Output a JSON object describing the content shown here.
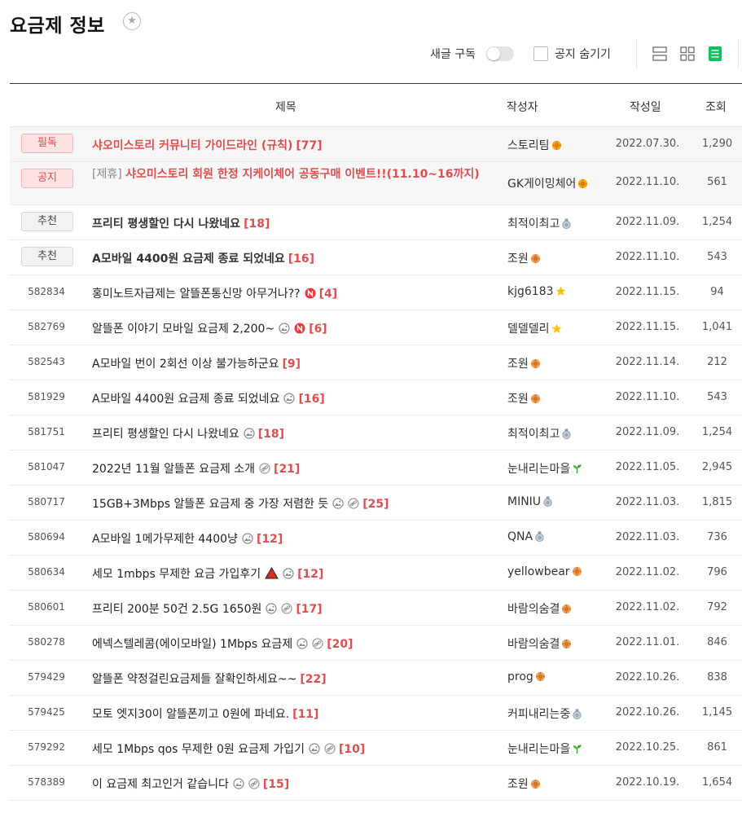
{
  "page": {
    "title": "요금제 정보"
  },
  "toolbar": {
    "subscribe_label": "새글 구독",
    "hide_notice_label": "공지 숨기기"
  },
  "table": {
    "headers": {
      "title": "제목",
      "author": "작성자",
      "date": "작성일",
      "views": "조회"
    },
    "rows": [
      {
        "badge": "필독",
        "badge_style": "red",
        "pre": "",
        "title": "샤오미스토리 커뮤니티 가이드라인 (규칙)",
        "title_style": "red",
        "comments": "[77]",
        "icons": [],
        "author": "스토리팀",
        "level": "gold",
        "date": "2022.07.30.",
        "views": "1,290",
        "notice": true,
        "tall": false
      },
      {
        "badge": "공지",
        "badge_style": "red",
        "pre": "[제휴] ",
        "title": "샤오미스토리 회원 한정 지케이체어 공동구매 이벤트!!(11.10~16까지)",
        "title_style": "red",
        "comments": "",
        "icons": [],
        "author": "GK게이밍체어",
        "level": "gold",
        "date": "2022.11.10.",
        "views": "561",
        "notice": true,
        "tall": true
      },
      {
        "badge": "추천",
        "badge_style": "gray",
        "pre": "",
        "title": "프리티 평생할인 다시 나왔네요",
        "title_style": "bold",
        "comments": "[18]",
        "icons": [],
        "author": "최적이최고",
        "level": "silver",
        "date": "2022.11.09.",
        "views": "1,254",
        "notice": false,
        "tall": false
      },
      {
        "badge": "추천",
        "badge_style": "gray",
        "pre": "",
        "title": "A모바일 4400원 요금제 종료 되었네요",
        "title_style": "bold",
        "comments": "[16]",
        "icons": [],
        "author": "조원",
        "level": "orange",
        "date": "2022.11.10.",
        "views": "543",
        "notice": false,
        "tall": false
      },
      {
        "num": "582834",
        "pre": "",
        "title": "홍미노트자급제는 알뜰폰통신망 아무거나??",
        "title_style": "",
        "comments": "[4]",
        "icons": [
          "new"
        ],
        "author": "kjg6183",
        "level": "star",
        "date": "2022.11.15.",
        "views": "94"
      },
      {
        "num": "582769",
        "pre": "",
        "title": "알뜰폰 이야기 모바일 요금제 2,200~",
        "title_style": "",
        "comments": "[6]",
        "icons": [
          "photo",
          "new"
        ],
        "author": "델델델리",
        "level": "star",
        "date": "2022.11.15.",
        "views": "1,041"
      },
      {
        "num": "582543",
        "pre": "",
        "title": "A모바일 번이 2회선 이상 불가능하군요",
        "title_style": "",
        "comments": "[9]",
        "icons": [],
        "author": "조원",
        "level": "orange",
        "date": "2022.11.14.",
        "views": "212"
      },
      {
        "num": "581929",
        "pre": "",
        "title": "A모바일 4400원 요금제 종료 되었네요",
        "title_style": "",
        "comments": "[16]",
        "icons": [
          "photo"
        ],
        "author": "조원",
        "level": "orange",
        "date": "2022.11.10.",
        "views": "543"
      },
      {
        "num": "581751",
        "pre": "",
        "title": "프리티 평생할인 다시 나왔네요",
        "title_style": "",
        "comments": "[18]",
        "icons": [
          "photo"
        ],
        "author": "최적이최고",
        "level": "silver",
        "date": "2022.11.09.",
        "views": "1,254"
      },
      {
        "num": "581047",
        "pre": "",
        "title": "2022년 11월 알뜰폰 요금제 소개",
        "title_style": "",
        "comments": "[21]",
        "icons": [
          "link"
        ],
        "author": "눈내리는마을",
        "level": "sprout",
        "date": "2022.11.05.",
        "views": "2,945"
      },
      {
        "num": "580717",
        "pre": "",
        "title": "15GB+3Mbps 알뜰폰 요금제 중 가장 저렴한 듯",
        "title_style": "",
        "comments": "[25]",
        "icons": [
          "photo",
          "link"
        ],
        "author": "MINIU",
        "level": "silver",
        "date": "2022.11.03.",
        "views": "1,815"
      },
      {
        "num": "580694",
        "pre": "",
        "title": "A모바일 1메가무제한 4400냥",
        "title_style": "",
        "comments": "[12]",
        "icons": [
          "photo"
        ],
        "author": "QNA",
        "level": "silver",
        "date": "2022.11.03.",
        "views": "736"
      },
      {
        "num": "580634",
        "pre": "",
        "title": "세모 1mbps 무제한 요금 가입후기",
        "title_style": "",
        "comments": "[12]",
        "icons": [
          "triangle",
          "photo"
        ],
        "author": "yellowbear",
        "level": "orange",
        "date": "2022.11.02.",
        "views": "796"
      },
      {
        "num": "580601",
        "pre": "",
        "title": "프리티 200분 50건 2.5G 1650원",
        "title_style": "",
        "comments": "[17]",
        "icons": [
          "photo",
          "link"
        ],
        "author": "바람의숨결",
        "level": "orange",
        "date": "2022.11.02.",
        "views": "792"
      },
      {
        "num": "580278",
        "pre": "",
        "title": "에넥스텔레콤(에이모바일) 1Mbps 요금제",
        "title_style": "",
        "comments": "[20]",
        "icons": [
          "photo",
          "link"
        ],
        "author": "바람의숨결",
        "level": "orange",
        "date": "2022.11.01.",
        "views": "846"
      },
      {
        "num": "579429",
        "pre": "",
        "title": "알뜰폰 약정걸린요금제들 잘확인하세요~~",
        "title_style": "",
        "comments": "[22]",
        "icons": [],
        "author": "prog",
        "level": "orange",
        "date": "2022.10.26.",
        "views": "838"
      },
      {
        "num": "579425",
        "pre": "",
        "title": "모토 엣지30이 알뜰폰끼고 0원에 파네요.",
        "title_style": "",
        "comments": "[11]",
        "icons": [],
        "author": "커피내리는중",
        "level": "silver",
        "date": "2022.10.26.",
        "views": "1,145"
      },
      {
        "num": "579292",
        "pre": "",
        "title": "세모 1Mbps qos 무제한 0원 요금제 가입기",
        "title_style": "",
        "comments": "[10]",
        "icons": [
          "photo",
          "link"
        ],
        "author": "눈내리는마을",
        "level": "sprout",
        "date": "2022.10.25.",
        "views": "861"
      },
      {
        "num": "578389",
        "pre": "",
        "title": "이 요금제 최고인거 같습니다",
        "title_style": "",
        "comments": "[15]",
        "icons": [
          "photo",
          "link"
        ],
        "author": "조원",
        "level": "orange",
        "date": "2022.10.19.",
        "views": "1,654"
      }
    ]
  },
  "colors": {
    "accent_red": "#e04e4e",
    "active_view_green": "#03c75a"
  }
}
